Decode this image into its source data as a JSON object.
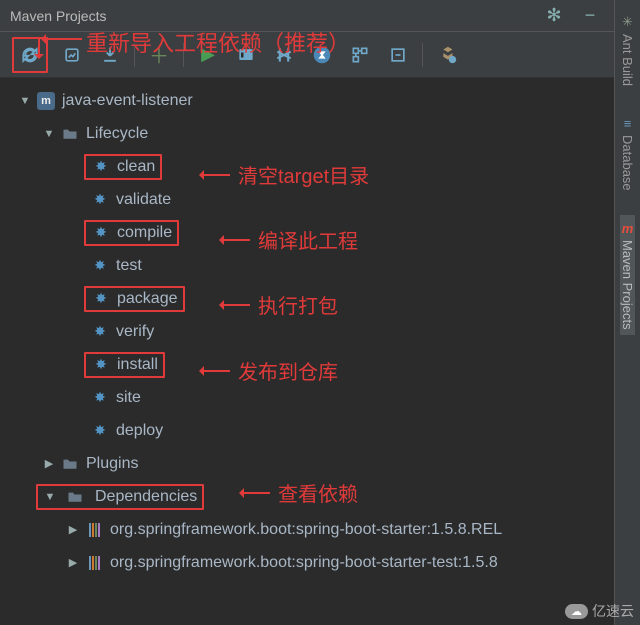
{
  "header": {
    "title": "Maven Projects"
  },
  "annotations": {
    "reimport": "重新导入工程依赖（推荐）",
    "clean": "清空target目录",
    "compile": "编译此工程",
    "package": "执行打包",
    "install": "发布到仓库",
    "dependencies": "查看依赖"
  },
  "project": {
    "name": "java-event-listener"
  },
  "lifecycle": {
    "label": "Lifecycle",
    "goals": [
      "clean",
      "validate",
      "compile",
      "test",
      "package",
      "verify",
      "install",
      "site",
      "deploy"
    ]
  },
  "plugins": {
    "label": "Plugins"
  },
  "dependencies": {
    "label": "Dependencies",
    "items": [
      "org.springframework.boot:spring-boot-starter:1.5.8.REL",
      "org.springframework.boot:spring-boot-starter-test:1.5.8"
    ]
  },
  "sideTabs": {
    "ant": "Ant Build",
    "db": "Database",
    "maven": "Maven Projects"
  },
  "watermark": "亿速云"
}
